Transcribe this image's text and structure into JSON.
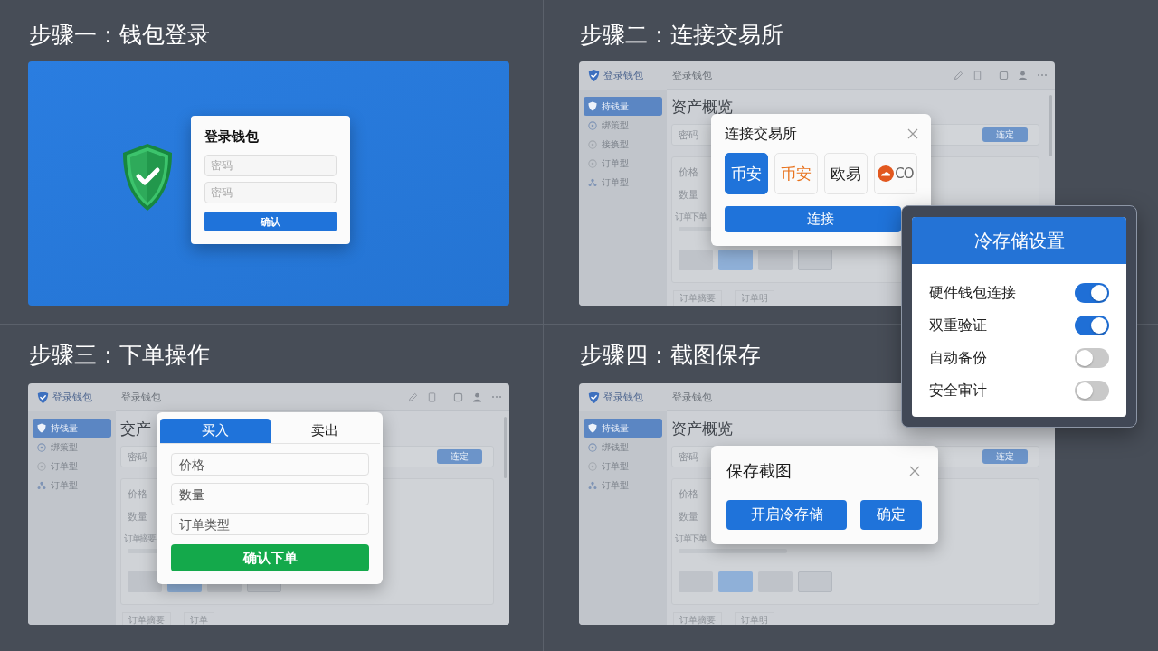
{
  "steps": [
    {
      "kind": "login",
      "title": "步骤一：钱包登录",
      "dialog": {
        "title": "登录钱包",
        "fields": [
          {
            "placeholder": "密码"
          },
          {
            "placeholder": "密码"
          }
        ],
        "button": "确认"
      }
    },
    {
      "kind": "exchange",
      "title": "步骤二：连接交易所",
      "app": {
        "brand": "登录钱包",
        "header": "登录钱包",
        "nav": [
          {
            "label": "持钱量",
            "selected": true
          },
          {
            "label": "绑策型",
            "selected": false
          },
          {
            "label": "接换型",
            "selected": false
          },
          {
            "label": "订单型",
            "selected": false
          },
          {
            "label": "订单型",
            "selected": false
          }
        ],
        "heading": "资产概览",
        "field": "密码",
        "field_button": "连定",
        "labels": [
          "价格",
          "数量"
        ],
        "note": "订单下单",
        "footer": [
          "订单摘要",
          "订单明"
        ]
      },
      "dialog": {
        "title": "连接交易所",
        "exchanges": [
          {
            "kind": "text",
            "label": "币安",
            "selected": true
          },
          {
            "kind": "text",
            "label": "币安",
            "selected": false,
            "color": "#e8731e"
          },
          {
            "kind": "text",
            "label": "欧易",
            "selected": false,
            "color": "#1c1c1c"
          },
          {
            "kind": "logo",
            "label": "CO",
            "selected": false,
            "color": "#e2581f"
          }
        ],
        "button": "连接"
      }
    },
    {
      "kind": "order",
      "title": "步骤三：下单操作",
      "app": {
        "brand": "登录钱包",
        "header": "登录钱包",
        "nav": [
          {
            "label": "持钱量",
            "selected": true
          },
          {
            "label": "绑策型",
            "selected": false
          },
          {
            "label": "订单型",
            "selected": false
          },
          {
            "label": "订单型",
            "selected": false
          }
        ],
        "heading": "交产",
        "field": "密码",
        "field_button": "连定",
        "labels": [
          "价格",
          "数量"
        ],
        "note": "订单摘要",
        "footer": [
          "订单摘要",
          "订单"
        ]
      },
      "dialog": {
        "tabs": [
          {
            "label": "买入",
            "selected": true
          },
          {
            "label": "卖出",
            "selected": false
          }
        ],
        "fields": [
          {
            "placeholder": "价格"
          },
          {
            "placeholder": "数量"
          },
          {
            "placeholder": "订单类型"
          }
        ],
        "button": "确认下单"
      }
    },
    {
      "kind": "save",
      "title": "步骤四：截图保存",
      "app": {
        "brand": "登录钱包",
        "header": "登录钱包",
        "nav": [
          {
            "label": "持钱量",
            "selected": true
          },
          {
            "label": "绑钱型",
            "selected": false
          },
          {
            "label": "订单型",
            "selected": false
          },
          {
            "label": "订单型",
            "selected": false
          }
        ],
        "heading": "资产概览",
        "field": "密码",
        "field_button": "连定",
        "labels": [
          "价格",
          "数量"
        ],
        "note": "订单下单",
        "footer": [
          "订单摘要",
          "订单明"
        ]
      },
      "dialog": {
        "title": "保存截图",
        "buttons": [
          "开启冷存储",
          "确定"
        ]
      }
    }
  ],
  "cold_storage": {
    "title": "冷存储设置",
    "options": [
      {
        "label": "硬件钱包连接",
        "on": true
      },
      {
        "label": "双重验证",
        "on": true
      },
      {
        "label": "自动备份",
        "on": false
      },
      {
        "label": "安全审计",
        "on": false
      }
    ]
  }
}
